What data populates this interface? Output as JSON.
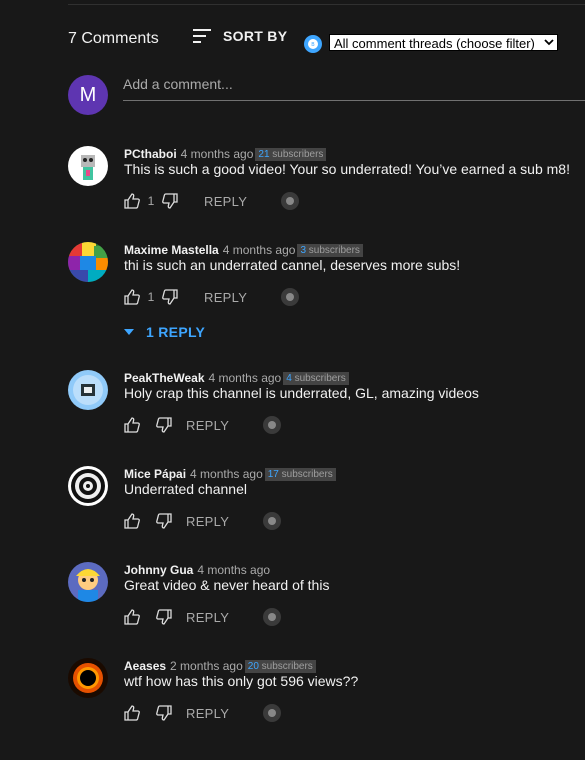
{
  "header": {
    "comment_count": "7 Comments",
    "sort_label": "SORT BY",
    "filter_value": "All comment threads (choose filter)"
  },
  "add_comment": {
    "avatar_letter": "M",
    "placeholder": "Add a comment..."
  },
  "reply_label": "REPLY",
  "comments": [
    {
      "author": "PCthaboi",
      "time": "4 months ago",
      "subs_count": "21",
      "subs_word": "subscribers",
      "text": "This is such a good video! Your so underrated! You’ve earned a sub m8!",
      "likes": "1"
    },
    {
      "author": "Maxime Mastella",
      "time": "4 months ago",
      "subs_count": "3",
      "subs_word": "subscribers",
      "text": "thi is such an underrated cannel, deserves more subs!",
      "likes": "1",
      "replies": "1 REPLY"
    },
    {
      "author": "PeakTheWeak",
      "time": "4 months ago",
      "subs_count": "4",
      "subs_word": "subscribers",
      "text": "Holy crap this channel is underrated, GL, amazing videos",
      "likes": ""
    },
    {
      "author": "Mice Pápai",
      "time": "4 months ago",
      "subs_count": "17",
      "subs_word": "subscribers",
      "text": "Underrated channel",
      "likes": ""
    },
    {
      "author": "Johnny Gua",
      "time": "4 months ago",
      "subs_count": "",
      "subs_word": "",
      "text": "Great video & never heard of this",
      "likes": ""
    },
    {
      "author": "Aeases",
      "time": "2 months ago",
      "subs_count": "20",
      "subs_word": "subscribers",
      "text": "wtf how has this only got 596 views??",
      "likes": ""
    }
  ],
  "colors": {
    "background": "#181818",
    "accent": "#3ea6ff",
    "avatar_m": "#5e35b1"
  }
}
